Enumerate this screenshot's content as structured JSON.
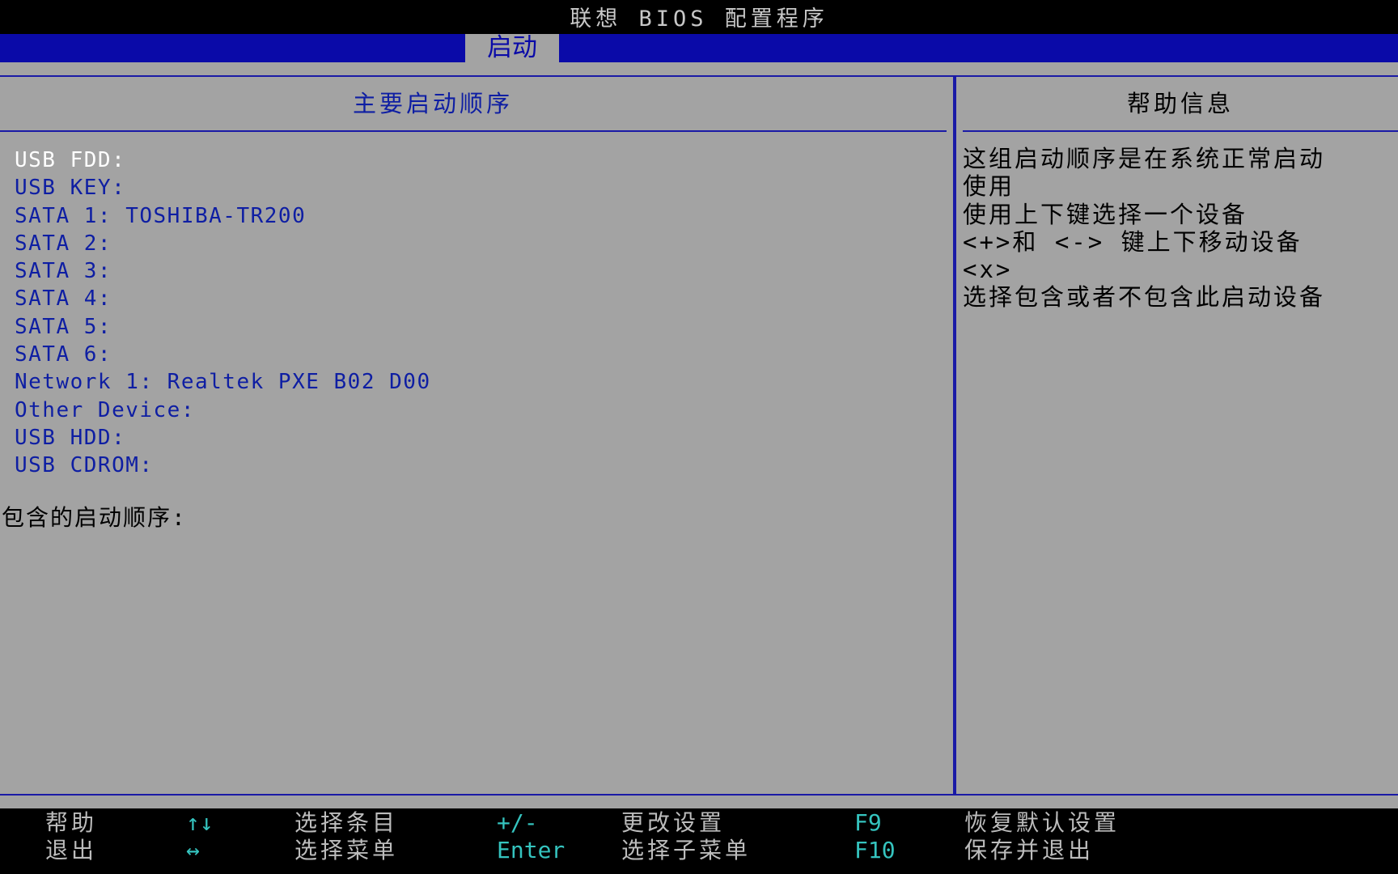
{
  "title": "联想 BIOS 配置程序",
  "active_tab": "启动",
  "main_panel": {
    "title": "主要启动顺序",
    "boot_items": [
      {
        "label": "USB FDD:",
        "selected": true
      },
      {
        "label": "USB KEY:",
        "selected": false
      },
      {
        "label": "SATA 1: TOSHIBA-TR200",
        "selected": false
      },
      {
        "label": "SATA 2:",
        "selected": false
      },
      {
        "label": "SATA 3:",
        "selected": false
      },
      {
        "label": "SATA 4:",
        "selected": false
      },
      {
        "label": "SATA 5:",
        "selected": false
      },
      {
        "label": "SATA 6:",
        "selected": false
      },
      {
        "label": "Network 1: Realtek PXE B02 D00",
        "selected": false
      },
      {
        "label": "Other Device:",
        "selected": false
      },
      {
        "label": "USB HDD:",
        "selected": false
      },
      {
        "label": "USB CDROM:",
        "selected": false
      }
    ],
    "include_label": "包含的启动顺序:"
  },
  "help_panel": {
    "title": "帮助信息",
    "lines": [
      "这组启动顺序是在系统正常启动",
      "使用",
      "使用上下键选择一个设备",
      "<+>和 <-> 键上下移动设备",
      "<x>",
      "选择包含或者不包含此启动设备"
    ]
  },
  "footer": [
    {
      "key": "帮助",
      "desc": ""
    },
    {
      "key": "退出",
      "desc": ""
    },
    {
      "key": "↑↓",
      "desc": "选择条目"
    },
    {
      "key": "↔",
      "desc": "选择菜单"
    },
    {
      "key": "+/-",
      "desc": "更改设置"
    },
    {
      "key": "Enter",
      "desc": "选择子菜单"
    },
    {
      "key": "F9",
      "desc": "恢复默认设置"
    },
    {
      "key": "F10",
      "desc": "保存并退出"
    }
  ],
  "colors": {
    "background": "#a3a3a3",
    "accent_blue": "#0a0aa8",
    "footer_key": "#35c4bf",
    "selected_text": "#ffffff"
  }
}
